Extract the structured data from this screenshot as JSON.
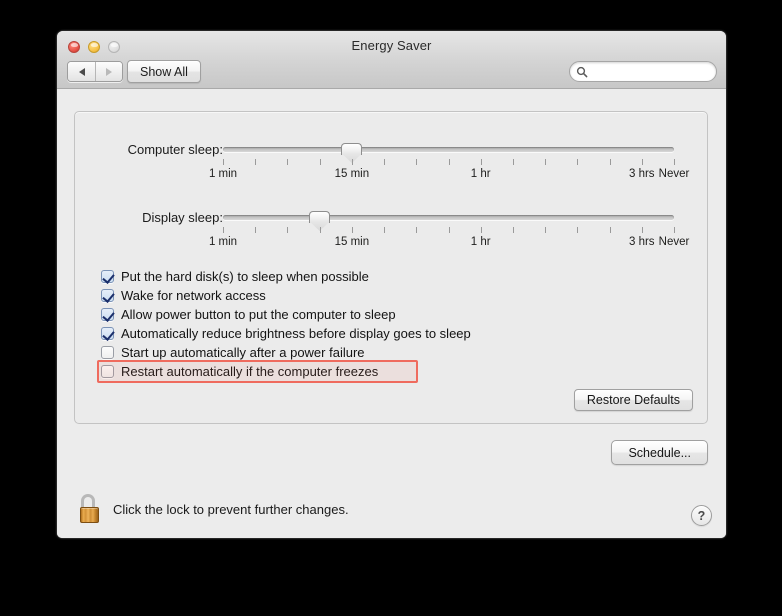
{
  "window": {
    "title": "Energy Saver",
    "traffic_lights": {
      "close": "close-button",
      "minimize": "minimize-button",
      "zoom": "zoom-button"
    },
    "colors": {
      "close": "#e24b40",
      "minimize": "#f4bd3f",
      "zoom": "#dcdcdc",
      "highlight": "#ef6b5e",
      "checkbox_check": "#1b2f6b",
      "lock_gold": "#d4933a"
    }
  },
  "toolbar": {
    "back_label": "back-arrow",
    "forward_label": "forward-arrow",
    "forward_disabled": true,
    "show_all_label": "Show All",
    "search": {
      "value": "",
      "placeholder": "",
      "icon": "search-icon"
    }
  },
  "sliders": [
    {
      "label": "Computer sleep:",
      "value_label": "15 min",
      "thumb_tick_index": 4,
      "tick_count": 15,
      "tick_labels": [
        {
          "text": "1 min",
          "tick_index": 0
        },
        {
          "text": "15 min",
          "tick_index": 4
        },
        {
          "text": "1 hr",
          "tick_index": 8
        },
        {
          "text": "3 hrs",
          "tick_index": 13
        },
        {
          "text": "Never",
          "tick_index": 14
        }
      ]
    },
    {
      "label": "Display sleep:",
      "value_label": "10 min",
      "thumb_tick_index": 3,
      "tick_count": 15,
      "tick_labels": [
        {
          "text": "1 min",
          "tick_index": 0
        },
        {
          "text": "15 min",
          "tick_index": 4
        },
        {
          "text": "1 hr",
          "tick_index": 8
        },
        {
          "text": "3 hrs",
          "tick_index": 13
        },
        {
          "text": "Never",
          "tick_index": 14
        }
      ]
    }
  ],
  "checkboxes": [
    {
      "label": "Put the hard disk(s) to sleep when possible",
      "checked": true,
      "highlighted": false
    },
    {
      "label": "Wake for network access",
      "checked": true,
      "highlighted": false
    },
    {
      "label": "Allow power button to put the computer to sleep",
      "checked": true,
      "highlighted": false
    },
    {
      "label": "Automatically reduce brightness before display goes to sleep",
      "checked": true,
      "highlighted": false
    },
    {
      "label": "Start up automatically after a power failure",
      "checked": false,
      "highlighted": false
    },
    {
      "label": "Restart automatically if the computer freezes",
      "checked": false,
      "highlighted": true
    }
  ],
  "buttons": {
    "restore_defaults": "Restore Defaults",
    "schedule": "Schedule..."
  },
  "footer": {
    "lock_icon": "open-padlock-icon",
    "lock_text": "Click the lock to prevent further changes.",
    "help_label": "?"
  }
}
